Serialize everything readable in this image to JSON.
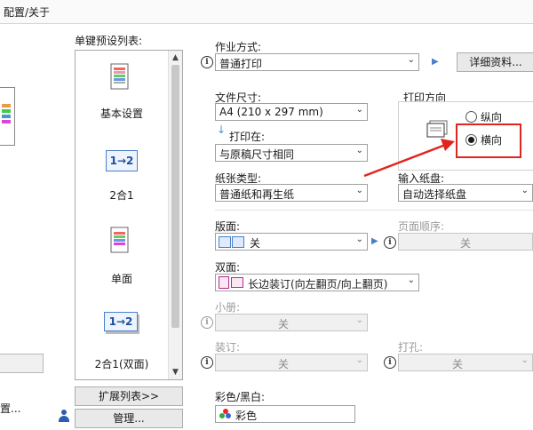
{
  "tabs": {
    "config_about": "配置/关于"
  },
  "left": {
    "more_label": "置..."
  },
  "presets": {
    "title": "单键预设列表:",
    "items": [
      {
        "label": "基本设置",
        "icon": "document-icon"
      },
      {
        "label": "2合1",
        "icon": "two-in-one-icon",
        "glyph": "1→2"
      },
      {
        "label": "单面",
        "icon": "single-sided-icon"
      },
      {
        "label": "2合1(双面)",
        "icon": "two-in-one-duplex-icon",
        "glyph": "1→2"
      }
    ],
    "expand_button": "扩展列表>>",
    "manage_button": "管理..."
  },
  "job": {
    "label": "作业方式:",
    "value": "普通打印",
    "details_button": "详细资料..."
  },
  "file_size": {
    "label": "文件尺寸:",
    "value": "A4 (210 x 297 mm)"
  },
  "print_on": {
    "label": "打印在:",
    "value": "与原稿尺寸相同"
  },
  "orientation": {
    "label": "打印方向",
    "portrait": "纵向",
    "landscape": "横向",
    "selected": "landscape"
  },
  "paper_type": {
    "label": "纸张类型:",
    "value": "普通纸和再生纸"
  },
  "input_tray": {
    "label": "输入纸盘:",
    "value": "自动选择纸盘"
  },
  "layout": {
    "label": "版面:",
    "value": "关"
  },
  "page_order": {
    "label": "页面顺序:",
    "value": "关"
  },
  "duplex": {
    "label": "双面:",
    "value": "长边装订(向左翻页/向上翻页)"
  },
  "booklet": {
    "label": "小册:",
    "value": "关"
  },
  "binding": {
    "label": "装订:",
    "value": "关"
  },
  "punch": {
    "label": "打孔:",
    "value": "关"
  },
  "color": {
    "label": "彩色/黑白:",
    "value": "彩色"
  },
  "colors": {
    "highlight": "#e0251e",
    "arrow": "#e0251e",
    "accent": "#4a7fc8"
  }
}
